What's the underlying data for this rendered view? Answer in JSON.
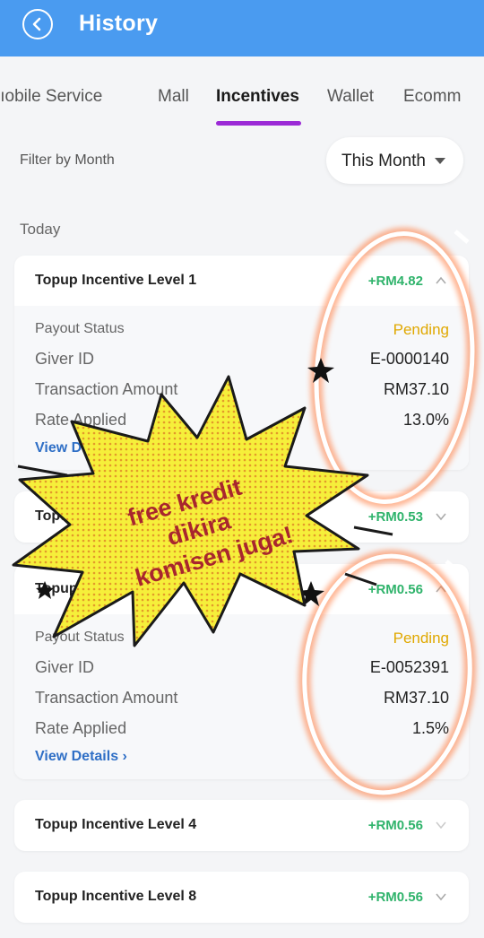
{
  "header": {
    "title": "History",
    "back_icon": "back-arrow-icon"
  },
  "tabs": [
    {
      "label": "’ıobile Service"
    },
    {
      "label": "Mall"
    },
    {
      "label": "Incentives",
      "active": true
    },
    {
      "label": "Wallet"
    },
    {
      "label": "Ecomm"
    }
  ],
  "filter": {
    "label": "Filter by Month",
    "selected": "This Month"
  },
  "date_group": "Today",
  "cards": [
    {
      "title": "Topup Incentive Level 1",
      "amount": "+RM4.82",
      "expanded": true,
      "payout_status_label": "Payout Status",
      "payout_status": "Pending",
      "giver_id_label": "Giver ID",
      "giver_id": "E-0000140",
      "transaction_amount_label": "Transaction Amount",
      "transaction_amount": "RM37.10",
      "rate_applied_label": "Rate Applied",
      "rate_applied": "13.0%",
      "view_details": "View Deta"
    },
    {
      "title": "Topu",
      "amount": "+RM0.53",
      "expanded": false
    },
    {
      "title": "Topup",
      "amount": "+RM0.56",
      "expanded": true,
      "payout_status_label": "Payout Status",
      "payout_status": "Pending",
      "giver_id_label": "Giver ID",
      "giver_id": "E-0052391",
      "transaction_amount_label": "Transaction Amount",
      "transaction_amount": "RM37.10",
      "rate_applied_label": "Rate Applied",
      "rate_applied": "1.5%",
      "view_details": "View Details"
    },
    {
      "title": "Topup Incentive Level 4",
      "amount": "+RM0.56",
      "expanded": false
    },
    {
      "title": "Topup Incentive Level 8",
      "amount": "+RM0.56",
      "expanded": false
    }
  ],
  "sticker": {
    "line1": "free kredit",
    "line2": "dikira",
    "line3": "komisen juga!"
  },
  "colors": {
    "header": "#4a9bf0",
    "tab_underline": "#9b2ad6",
    "amount": "#2fb36b",
    "pending": "#e0a800",
    "link": "#2f6fc6",
    "sticker_fill": "#f6ef3a",
    "sticker_text": "#a8262e"
  }
}
